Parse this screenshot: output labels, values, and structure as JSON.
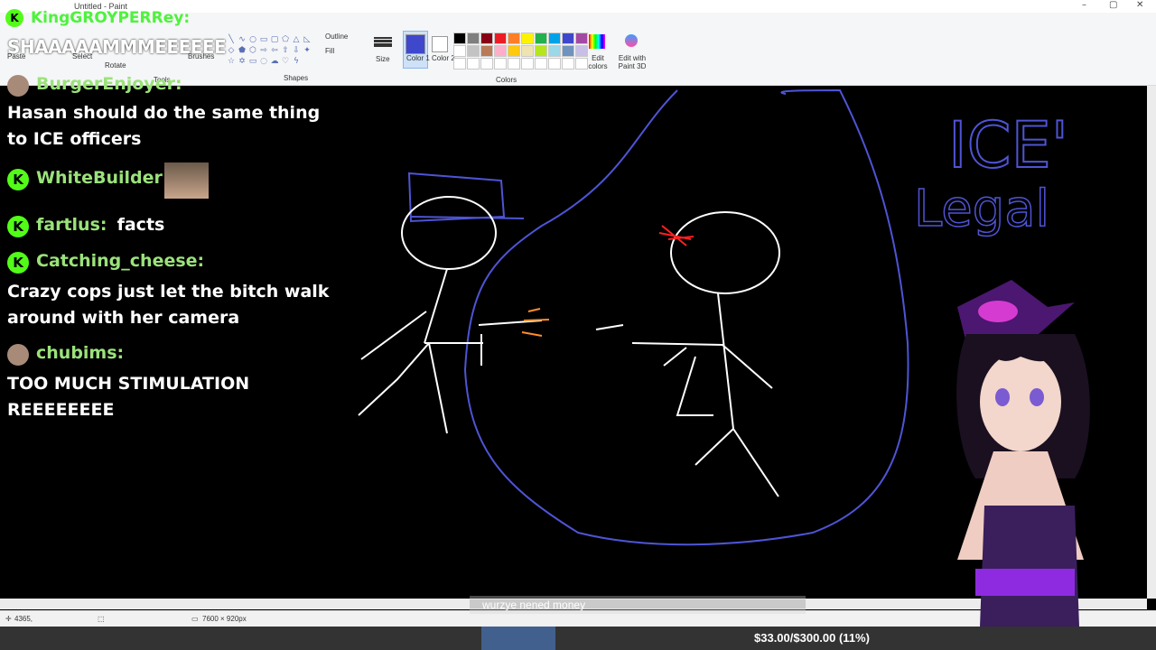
{
  "app": {
    "window_title": "Untitled - Paint"
  },
  "ribbon": {
    "groups": {
      "shapes": "Shapes",
      "colors": "Colors",
      "tools": "Tools"
    },
    "buttons": {
      "paste": "Paste",
      "select": "Select",
      "rotate": "Rotate",
      "brushes": "Brushes",
      "outline": "Outline",
      "fill": "Fill",
      "size": "Size",
      "color1": "Color 1",
      "color2": "Color 2",
      "edit_colors": "Edit colors",
      "edit_paint3d": "Edit with Paint 3D"
    },
    "color1_value": "#3f48cc",
    "color2_value": "#ffffff",
    "palette": [
      "#000000",
      "#7f7f7f",
      "#880015",
      "#ed1c24",
      "#ff7f27",
      "#fff200",
      "#22b14c",
      "#00a2e8",
      "#3f48cc",
      "#a349a4",
      "#ffffff",
      "#c3c3c3",
      "#b97a57",
      "#ffaec9",
      "#ffc90e",
      "#efe4b0",
      "#b5e61d",
      "#99d9ea",
      "#7092be",
      "#c8bfe7",
      "#ffffff",
      "#ffffff",
      "#ffffff",
      "#ffffff",
      "#ffffff",
      "#ffffff",
      "#ffffff",
      "#ffffff",
      "#ffffff",
      "#ffffff"
    ]
  },
  "status": {
    "cursor_pos": "4365,",
    "canvas_size": "7600 × 920px"
  },
  "chat": {
    "top_user": "KingGROYPERRey:",
    "top_text": "SHAAAAAMMMEEEEEE",
    "messages": [
      {
        "user": "BurgerEnjoyer:",
        "text_line1": "Hasan should do the same thing",
        "text_line2": "to ICE officers"
      },
      {
        "user": "WhiteBuilder:",
        "text_line1": ""
      },
      {
        "user": "fartlus:",
        "text_line1": "facts"
      },
      {
        "user": "Catching_cheese:",
        "text_line1": "Crazy cops just let the bitch walk",
        "text_line2": "around with her camera"
      },
      {
        "user": "chubims:",
        "text_line1": "TOO MUCH STIMULATION",
        "text_line2": "REEEEEEEE"
      }
    ]
  },
  "drawing": {
    "annotation_top": "ICE'",
    "annotation_bottom": "Legal"
  },
  "goal": {
    "label": "wurzye nened money",
    "progress_text": "$33.00/$300.00 (11%)",
    "progress_fraction": 0.11
  }
}
